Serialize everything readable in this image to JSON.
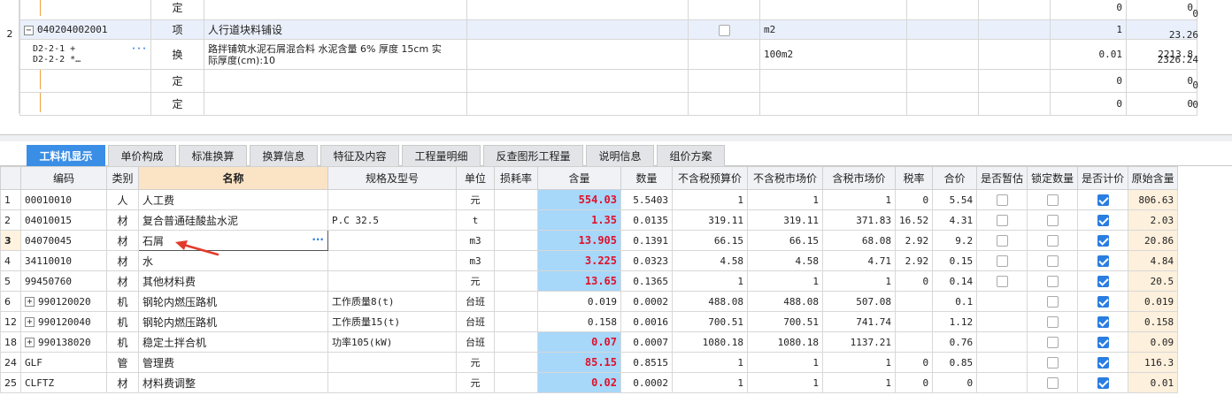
{
  "top_grid": {
    "rows": [
      {
        "num": "",
        "code": "",
        "type": "定",
        "name": "",
        "unit": "",
        "qty": "0",
        "price": "0",
        "total": "0"
      },
      {
        "num": "2",
        "code": "040204002001",
        "type": "项",
        "name": "人行道块料铺设",
        "unit": "m2",
        "qty": "1",
        "price": "",
        "total": "23.26"
      },
      {
        "num": "",
        "code_line1": "D2-2-1 +",
        "code_line2": "D2-2-2 *…",
        "type": "换",
        "name_line1": "路拌铺筑水泥石屑混合料 水泥含量 6% 厚度 15cm  实",
        "name_line2": "际厚度(cm):10",
        "unit": "100m2",
        "qty": "0.01",
        "price": "2213.8",
        "total": "2326.24"
      },
      {
        "num": "",
        "code": "",
        "type": "定",
        "name": "",
        "unit": "",
        "qty": "0",
        "price": "0",
        "total": "0"
      },
      {
        "num": "",
        "code": "",
        "type": "定",
        "name": "",
        "unit": "",
        "qty": "0",
        "price": "0",
        "total": "0"
      }
    ]
  },
  "tabs": [
    "工料机显示",
    "单价构成",
    "标准换算",
    "换算信息",
    "特征及内容",
    "工程量明细",
    "反查图形工程量",
    "说明信息",
    "组价方案"
  ],
  "table": {
    "headers": [
      "编码",
      "类别",
      "名称",
      "规格及型号",
      "单位",
      "损耗率",
      "含量",
      "数量",
      "不含税预算价",
      "不含税市场价",
      "含税市场价",
      "税率",
      "合价",
      "是否暂估",
      "锁定数量",
      "是否计价",
      "原始含量"
    ],
    "rows": [
      {
        "rn": "1",
        "code": "00010010",
        "cat": "人",
        "name": "人工费",
        "spec": "",
        "unit": "元",
        "loss": "",
        "content": "554.03",
        "amount": "5.5403",
        "p1": "1",
        "p2": "1",
        "p3": "1",
        "tax": "0",
        "total": "5.54",
        "est": false,
        "lock": false,
        "priced": true,
        "orig": "806.63",
        "plus": false,
        "hl": true
      },
      {
        "rn": "2",
        "code": "04010015",
        "cat": "材",
        "name": "复合普通硅酸盐水泥",
        "spec": "P.C 32.5",
        "unit": "t",
        "loss": "",
        "content": "1.35",
        "amount": "0.0135",
        "p1": "319.11",
        "p2": "319.11",
        "p3": "371.83",
        "tax": "16.52",
        "total": "4.31",
        "est": false,
        "lock": false,
        "priced": true,
        "orig": "2.03",
        "plus": false,
        "hl": true
      },
      {
        "rn": "3",
        "code": "04070045",
        "cat": "材",
        "name": "石屑",
        "spec": "",
        "unit": "m3",
        "loss": "",
        "content": "13.905",
        "amount": "0.1391",
        "p1": "66.15",
        "p2": "66.15",
        "p3": "68.08",
        "tax": "2.92",
        "total": "9.2",
        "est": false,
        "lock": false,
        "priced": true,
        "orig": "20.86",
        "plus": false,
        "hl": true
      },
      {
        "rn": "4",
        "code": "34110010",
        "cat": "材",
        "name": "水",
        "spec": "",
        "unit": "m3",
        "loss": "",
        "content": "3.225",
        "amount": "0.0323",
        "p1": "4.58",
        "p2": "4.58",
        "p3": "4.71",
        "tax": "2.92",
        "total": "0.15",
        "est": false,
        "lock": false,
        "priced": true,
        "orig": "4.84",
        "plus": false,
        "hl": true
      },
      {
        "rn": "5",
        "code": "99450760",
        "cat": "材",
        "name": "其他材料费",
        "spec": "",
        "unit": "元",
        "loss": "",
        "content": "13.65",
        "amount": "0.1365",
        "p1": "1",
        "p2": "1",
        "p3": "1",
        "tax": "0",
        "total": "0.14",
        "est": false,
        "lock": false,
        "priced": true,
        "orig": "20.5",
        "plus": false,
        "hl": true
      },
      {
        "rn": "6",
        "code": "990120020",
        "cat": "机",
        "name": "钢轮内燃压路机",
        "spec": "工作质量8(t)",
        "unit": "台班",
        "loss": "",
        "content": "0.019",
        "amount": "0.0002",
        "p1": "488.08",
        "p2": "488.08",
        "p3": "507.08",
        "tax": "",
        "total": "0.1",
        "est": null,
        "lock": false,
        "priced": true,
        "orig": "0.019",
        "plus": true,
        "hl": false
      },
      {
        "rn": "12",
        "code": "990120040",
        "cat": "机",
        "name": "钢轮内燃压路机",
        "spec": "工作质量15(t)",
        "unit": "台班",
        "loss": "",
        "content": "0.158",
        "amount": "0.0016",
        "p1": "700.51",
        "p2": "700.51",
        "p3": "741.74",
        "tax": "",
        "total": "1.12",
        "est": null,
        "lock": false,
        "priced": true,
        "orig": "0.158",
        "plus": true,
        "hl": false
      },
      {
        "rn": "18",
        "code": "990138020",
        "cat": "机",
        "name": "稳定土拌合机",
        "spec": "功率105(kW)",
        "unit": "台班",
        "loss": "",
        "content": "0.07",
        "amount": "0.0007",
        "p1": "1080.18",
        "p2": "1080.18",
        "p3": "1137.21",
        "tax": "",
        "total": "0.76",
        "est": null,
        "lock": false,
        "priced": true,
        "orig": "0.09",
        "plus": true,
        "hl": true
      },
      {
        "rn": "24",
        "code": "GLF",
        "cat": "管",
        "name": "管理费",
        "spec": "",
        "unit": "元",
        "loss": "",
        "content": "85.15",
        "amount": "0.8515",
        "p1": "1",
        "p2": "1",
        "p3": "1",
        "tax": "0",
        "total": "0.85",
        "est": null,
        "lock": false,
        "priced": true,
        "orig": "116.3",
        "plus": false,
        "hl": true
      },
      {
        "rn": "25",
        "code": "CLFTZ",
        "cat": "材",
        "name": "材料费调整",
        "spec": "",
        "unit": "元",
        "loss": "",
        "content": "0.02",
        "amount": "0.0002",
        "p1": "1",
        "p2": "1",
        "p3": "1",
        "tax": "0",
        "total": "0",
        "est": null,
        "lock": false,
        "priced": true,
        "orig": "0.01",
        "plus": false,
        "hl": true
      }
    ]
  },
  "colors": {
    "accent": "#3a8ee6",
    "highlight_cell": "#a7d7f9",
    "red_value": "#e0102a",
    "orig_bg": "#fdf0dc",
    "arrow": "#e23a2a"
  }
}
